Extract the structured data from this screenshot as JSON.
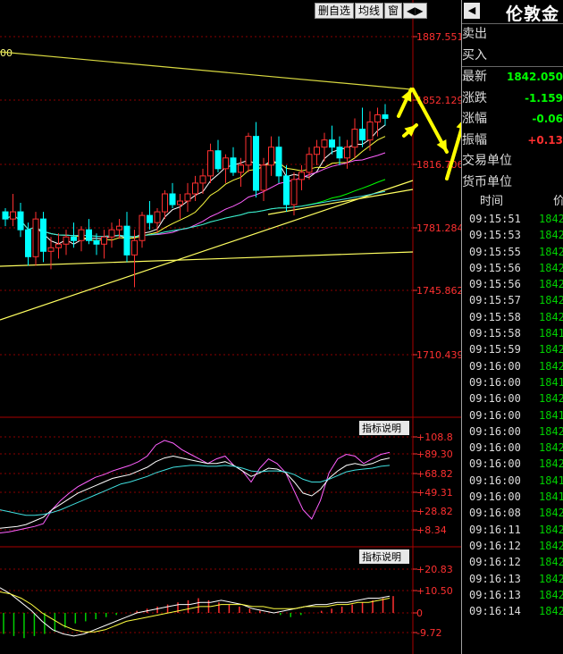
{
  "toolbar": {
    "items": [
      "删自选",
      "均线",
      "窗",
      "◀▶"
    ]
  },
  "sidebar": {
    "title": "伦敦金",
    "nav_glyph": "◀",
    "rows": [
      {
        "label": "卖出",
        "value": "",
        "color": "#ffffff"
      },
      {
        "label": "买入",
        "value": "",
        "color": "#ffffff"
      },
      {
        "label": "最新",
        "value": "1842.050",
        "color": "#00ff00"
      },
      {
        "label": "涨跌",
        "value": "-1.159",
        "color": "#00ff00"
      },
      {
        "label": "涨幅",
        "value": "-0.06",
        "color": "#00ff00"
      },
      {
        "label": "振幅",
        "value": "+0.13",
        "color": "#ff3030"
      },
      {
        "label": "交易单位",
        "value": "",
        "color": "#ffffff"
      },
      {
        "label": "货币单位",
        "value": "",
        "color": "#ffffff"
      }
    ],
    "tick_header": {
      "time": "时间",
      "price": "价"
    },
    "ticks": [
      {
        "time": "09:15:51",
        "price": "1842"
      },
      {
        "time": "09:15:53",
        "price": "1842"
      },
      {
        "time": "09:15:55",
        "price": "1842"
      },
      {
        "time": "09:15:56",
        "price": "1842"
      },
      {
        "time": "09:15:56",
        "price": "1842"
      },
      {
        "time": "09:15:57",
        "price": "1842"
      },
      {
        "time": "09:15:58",
        "price": "1842"
      },
      {
        "time": "09:15:58",
        "price": "1841"
      },
      {
        "time": "09:15:59",
        "price": "1842"
      },
      {
        "time": "09:16:00",
        "price": "1842"
      },
      {
        "time": "09:16:00",
        "price": "1841"
      },
      {
        "time": "09:16:00",
        "price": "1842"
      },
      {
        "time": "09:16:00",
        "price": "1841"
      },
      {
        "time": "09:16:00",
        "price": "1842"
      },
      {
        "time": "09:16:00",
        "price": "1842"
      },
      {
        "time": "09:16:00",
        "price": "1842"
      },
      {
        "time": "09:16:00",
        "price": "1841"
      },
      {
        "time": "09:16:00",
        "price": "1841"
      },
      {
        "time": "09:16:08",
        "price": "1842"
      },
      {
        "time": "09:16:11",
        "price": "1842"
      },
      {
        "time": "09:16:12",
        "price": "1842"
      },
      {
        "time": "09:16:12",
        "price": "1842"
      },
      {
        "time": "09:16:13",
        "price": "1842"
      },
      {
        "time": "09:16:13",
        "price": "1842"
      },
      {
        "time": "09:16:14",
        "price": "1842"
      }
    ]
  },
  "chart_data": [
    {
      "type": "candlestick",
      "panel": "price",
      "y_ticks": [
        "1887.551",
        "1852.129",
        "1816.706",
        "1781.284",
        "1745.862",
        "1710.439"
      ],
      "ylim": [
        1700,
        1895
      ],
      "ma_label": "00",
      "candles": [
        [
          1790,
          1792,
          1782,
          1786
        ],
        [
          1786,
          1800,
          1782,
          1790
        ],
        [
          1790,
          1795,
          1776,
          1780
        ],
        [
          1780,
          1784,
          1760,
          1765
        ],
        [
          1765,
          1790,
          1760,
          1786
        ],
        [
          1786,
          1790,
          1762,
          1768
        ],
        [
          1768,
          1776,
          1758,
          1770
        ],
        [
          1770,
          1778,
          1764,
          1772
        ],
        [
          1772,
          1780,
          1766,
          1776
        ],
        [
          1776,
          1784,
          1770,
          1774
        ],
        [
          1774,
          1782,
          1768,
          1780
        ],
        [
          1780,
          1786,
          1772,
          1774
        ],
        [
          1774,
          1778,
          1766,
          1772
        ],
        [
          1772,
          1780,
          1764,
          1776
        ],
        [
          1776,
          1784,
          1770,
          1780
        ],
        [
          1780,
          1786,
          1775,
          1782
        ],
        [
          1782,
          1790,
          1762,
          1766
        ],
        [
          1766,
          1780,
          1748,
          1774
        ],
        [
          1774,
          1790,
          1770,
          1788
        ],
        [
          1788,
          1796,
          1780,
          1784
        ],
        [
          1784,
          1792,
          1778,
          1790
        ],
        [
          1790,
          1802,
          1786,
          1800
        ],
        [
          1800,
          1806,
          1792,
          1794
        ],
        [
          1794,
          1800,
          1786,
          1796
        ],
        [
          1796,
          1806,
          1790,
          1800
        ],
        [
          1800,
          1810,
          1796,
          1806
        ],
        [
          1806,
          1814,
          1800,
          1810
        ],
        [
          1810,
          1828,
          1806,
          1824
        ],
        [
          1824,
          1830,
          1812,
          1814
        ],
        [
          1814,
          1822,
          1806,
          1820
        ],
        [
          1820,
          1826,
          1810,
          1812
        ],
        [
          1812,
          1820,
          1804,
          1816
        ],
        [
          1816,
          1834,
          1812,
          1832
        ],
        [
          1832,
          1840,
          1798,
          1802
        ],
        [
          1802,
          1820,
          1796,
          1816
        ],
        [
          1816,
          1832,
          1810,
          1826
        ],
        [
          1826,
          1832,
          1806,
          1810
        ],
        [
          1810,
          1816,
          1790,
          1794
        ],
        [
          1794,
          1812,
          1788,
          1808
        ],
        [
          1808,
          1816,
          1802,
          1812
        ],
        [
          1812,
          1826,
          1808,
          1822
        ],
        [
          1822,
          1830,
          1816,
          1826
        ],
        [
          1826,
          1834,
          1818,
          1830
        ],
        [
          1830,
          1838,
          1822,
          1826
        ],
        [
          1826,
          1832,
          1816,
          1820
        ],
        [
          1820,
          1830,
          1814,
          1826
        ],
        [
          1826,
          1842,
          1820,
          1836
        ],
        [
          1836,
          1848,
          1826,
          1830
        ],
        [
          1830,
          1846,
          1824,
          1840
        ],
        [
          1840,
          1848,
          1832,
          1844
        ],
        [
          1844,
          1850,
          1838,
          1842
        ]
      ]
    },
    {
      "type": "line",
      "panel": "indicator1",
      "label": "指标说明",
      "y_ticks": [
        "+108.8",
        "+89.30",
        "+68.82",
        "+49.31",
        "+28.82",
        "+8.34"
      ],
      "ylim": [
        0,
        115
      ],
      "series": [
        {
          "color": "#ff60ff",
          "values": [
            5,
            6,
            8,
            10,
            12,
            15,
            30,
            40,
            48,
            55,
            60,
            65,
            68,
            72,
            75,
            78,
            82,
            88,
            100,
            105,
            102,
            95,
            90,
            85,
            80,
            85,
            88,
            78,
            72,
            60,
            75,
            85,
            80,
            70,
            50,
            30,
            20,
            40,
            70,
            85,
            90,
            88,
            80,
            85,
            90,
            92
          ]
        },
        {
          "color": "#ffffff",
          "values": [
            10,
            11,
            12,
            14,
            18,
            22,
            30,
            36,
            42,
            48,
            52,
            56,
            60,
            64,
            66,
            68,
            72,
            76,
            82,
            86,
            88,
            86,
            84,
            82,
            80,
            80,
            82,
            78,
            72,
            66,
            70,
            75,
            74,
            70,
            60,
            48,
            45,
            52,
            64,
            72,
            78,
            80,
            78,
            80,
            84,
            86
          ]
        },
        {
          "color": "#40e0e0",
          "values": [
            30,
            28,
            26,
            24,
            24,
            25,
            27,
            30,
            34,
            38,
            42,
            46,
            50,
            54,
            58,
            60,
            63,
            66,
            70,
            73,
            76,
            77,
            78,
            78,
            77,
            77,
            78,
            77,
            75,
            72,
            71,
            72,
            72,
            71,
            68,
            63,
            60,
            60,
            63,
            67,
            71,
            73,
            74,
            75,
            77,
            78
          ]
        }
      ]
    },
    {
      "type": "bar+line",
      "panel": "indicator2",
      "label": "指标说明",
      "y_ticks": [
        "+20.83",
        "+10.50",
        "0",
        "-9.72"
      ],
      "ylim": [
        -16,
        25
      ],
      "bars": [
        -10,
        -11,
        -12,
        -11,
        -10,
        -9,
        -7,
        -5,
        -4,
        -3,
        -2,
        -1,
        0,
        1,
        2,
        3,
        4,
        5,
        6,
        7,
        6,
        5,
        4,
        3,
        2,
        1,
        0,
        -1,
        -2,
        -1,
        0,
        1,
        2,
        3,
        4,
        5,
        6,
        7,
        8
      ],
      "series": [
        {
          "color": "#ffffff",
          "values": [
            12,
            9,
            5,
            1,
            -4,
            -8,
            -10,
            -11,
            -10,
            -8,
            -6,
            -4,
            -2,
            0,
            1,
            2,
            3,
            4,
            4,
            5,
            5,
            6,
            5,
            4,
            2,
            1,
            0,
            1,
            2,
            3,
            4,
            4,
            5,
            5,
            6,
            7,
            7,
            8
          ]
        },
        {
          "color": "#ffff40",
          "values": [
            10,
            9,
            7,
            4,
            0,
            -3,
            -6,
            -8,
            -9,
            -9,
            -8,
            -6,
            -4,
            -3,
            -2,
            -1,
            0,
            1,
            2,
            3,
            3,
            4,
            4,
            4,
            3,
            3,
            2,
            2,
            2,
            3,
            3,
            3,
            4,
            4,
            5,
            5,
            6,
            7
          ]
        }
      ]
    }
  ],
  "colors": {
    "up": "#ff3030",
    "down": "#00ffff",
    "grid": "#8b0000",
    "axis_text": "#ff3030",
    "arrow": "#ffff00"
  }
}
